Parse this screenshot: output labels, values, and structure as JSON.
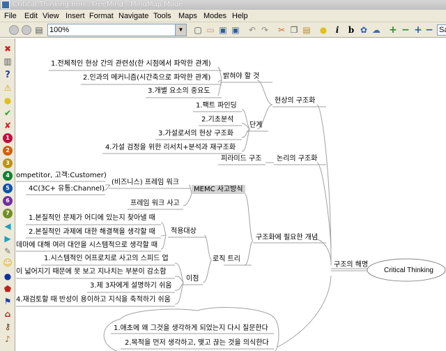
{
  "window": {
    "title": "Critical Thinking.mm - FreeMind - MindMap Mode"
  },
  "menu": [
    "File",
    "Edit",
    "View",
    "Insert",
    "Format",
    "Navigate",
    "Tools",
    "Maps",
    "Modes",
    "Help"
  ],
  "toolbar": {
    "zoom_value": "100%",
    "search_value": "Sa",
    "icons": [
      "back-icon",
      "forward-icon",
      "print-icon",
      "new-icon",
      "open-icon",
      "save-icon",
      "save-as-icon",
      "undo-icon",
      "redo-icon",
      "cut-icon",
      "copy-icon",
      "paste-icon",
      "idea-icon",
      "italic-icon",
      "bold-icon",
      "font-icon",
      "cloud-icon",
      "zoom-in-icon",
      "zoom-out-icon",
      "zoom-in2-icon",
      "zoom-out2-icon"
    ],
    "italic_glyph": "i",
    "bold_glyph": "b"
  },
  "iconbar": {
    "numbers": [
      "1",
      "2",
      "3",
      "4",
      "5",
      "6",
      "7"
    ]
  },
  "colors": {
    "line": "#a0a0a0",
    "highlight": "#d3d3d3",
    "menubar": "#ece9d8"
  },
  "mindmap": {
    "root": "Critical Thinking",
    "branch": "구조의 해명",
    "structure": {
      "label": "현상의 구조화",
      "grasp": {
        "label": "밝혀야 할 것",
        "items": [
          "1.전체적인 현상 간의 관련성(한 시점에서 파악한 관계)",
          "2.인과의 메커니즘(시간축으로 파악한 관계)",
          "3.개별 요소의 중요도"
        ]
      },
      "steps": {
        "label": "단계",
        "items": [
          "1.팩트 파인딩",
          "2.기초분석",
          "3.가설로서의 현상 구조화",
          "4.가설 검정을 위한 리서치+분석과 재구조화"
        ]
      }
    },
    "logic": {
      "label": "논리의 구조화",
      "items": [
        "피라미드 구조"
      ]
    },
    "concepts": {
      "label": "구조화에 필요한 개념",
      "memc": {
        "label": "MEMC 사고방식",
        "framework": {
          "label": "(비즈니스) 프레임 워크",
          "items": [
            "ompetitor, 고객:Customer)",
            "4C(3C+ 유통:Channel)"
          ]
        },
        "thinking": "프레임 워크 사고"
      },
      "logic_tree": {
        "label": "로직 트리",
        "targets": {
          "label": "적용대상",
          "items": [
            "1.본질적인 문제가 어디에 있는지 찾아낼 때",
            "2.본질적인 과제에 대한 해결책을 생각할 때",
            "데마에 대해 여러 대안을 시스템적으로 생각할 때"
          ]
        },
        "benefits": {
          "label": "이점",
          "items": [
            "1.시스템적인 어프로치로 사고의 스피드 업",
            "이 넓어지기 때문에 못 보고 지나치는 부분이 감소함",
            "3.제 3자에게 설명하기 쉬움",
            "4.재검토할 때 반성이 용이하고 지식을 축적하기 쉬움"
          ]
        }
      }
    },
    "cloud": {
      "items": [
        "1.애초에 왜 그것을 생각하게 되었는지 다시 질문한다",
        "2.목적을 먼저 생각하고, 맺고 끊는 것을 의식한다"
      ]
    }
  }
}
